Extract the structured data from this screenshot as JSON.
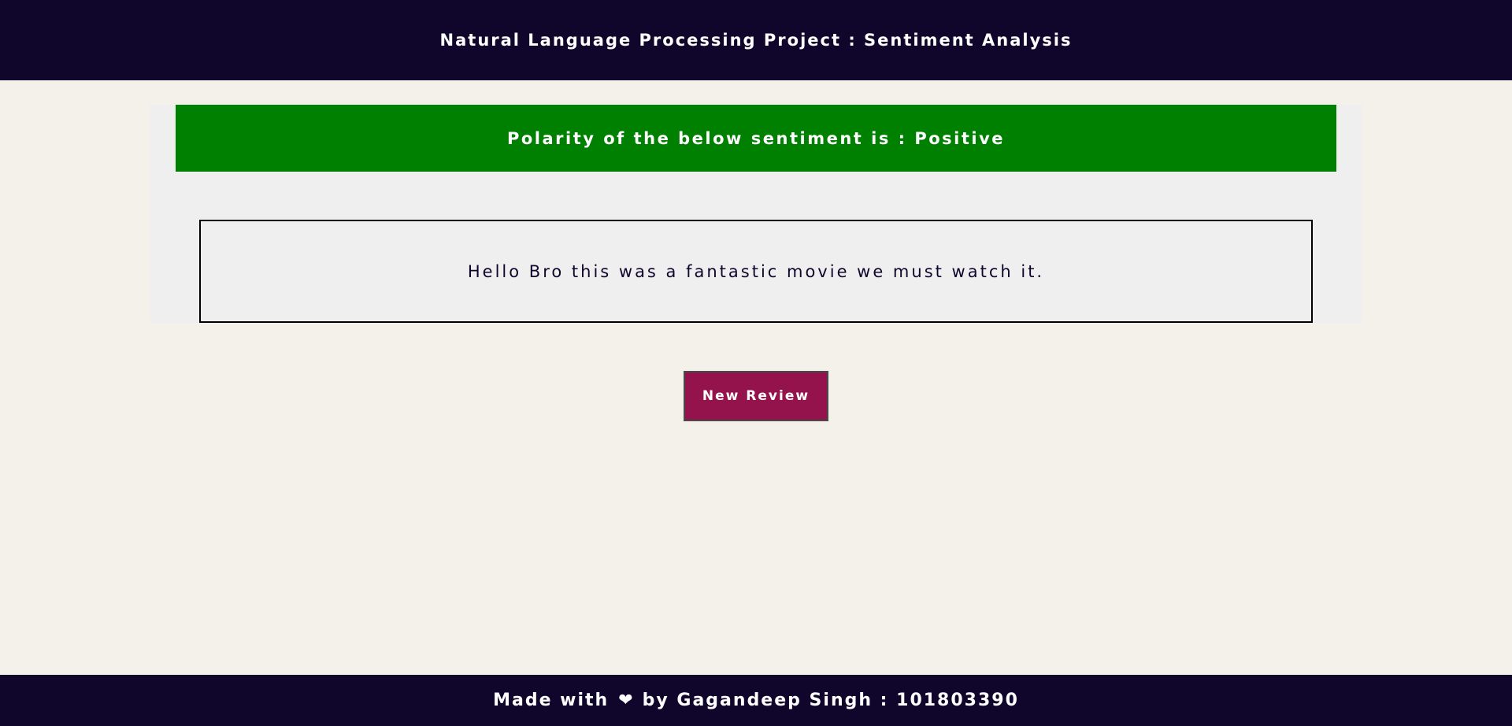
{
  "header": {
    "title": "Natural Language Processing Project : Sentiment Analysis"
  },
  "result": {
    "banner_text": "Polarity of the below sentiment is : Positive",
    "banner_color": "#008000",
    "review_text": "Hello Bro this was a fantastic movie we must watch it."
  },
  "actions": {
    "new_review_label": "New Review",
    "button_color": "#95134d"
  },
  "footer": {
    "prefix": "Made with",
    "icon": "heart-icon",
    "suffix": "by Gagandeep Singh : 101803390"
  },
  "colors": {
    "header_bg": "#10062b",
    "page_bg": "#f4f0ea",
    "panel_bg": "#efefef"
  }
}
